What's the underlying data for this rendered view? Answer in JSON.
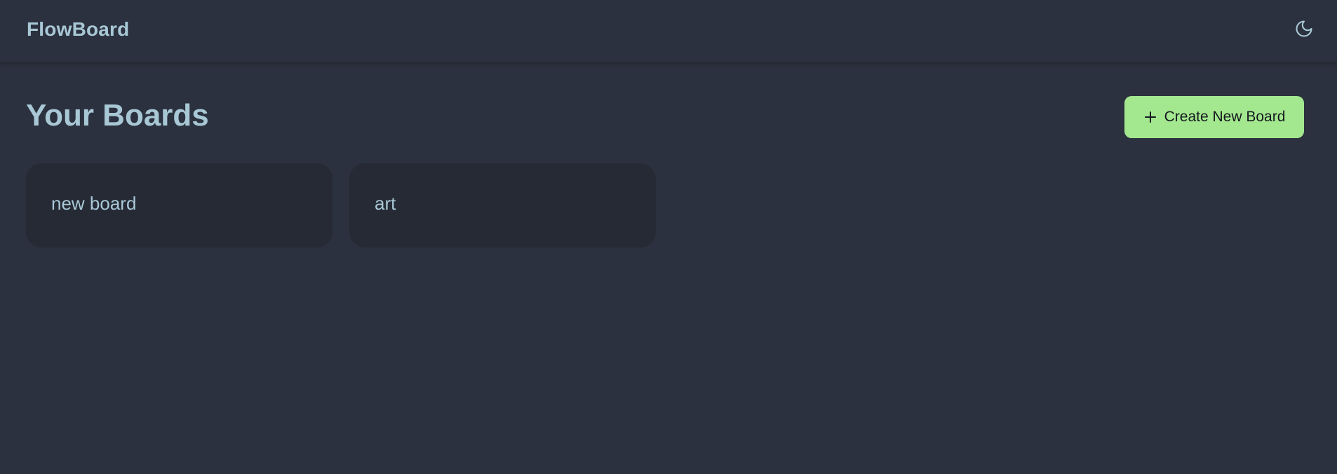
{
  "header": {
    "brand": "FlowBoard",
    "theme_toggle_icon": "moon-icon"
  },
  "main": {
    "title": "Your Boards",
    "create_button": {
      "label": "Create New Board",
      "icon": "plus-icon",
      "color": "#a3e88f"
    },
    "boards": [
      {
        "name": "new board"
      },
      {
        "name": "art"
      }
    ]
  },
  "colors": {
    "background": "#2b313e",
    "card": "#252a35",
    "text": "#a9c8d6",
    "accent": "#a3e88f"
  }
}
